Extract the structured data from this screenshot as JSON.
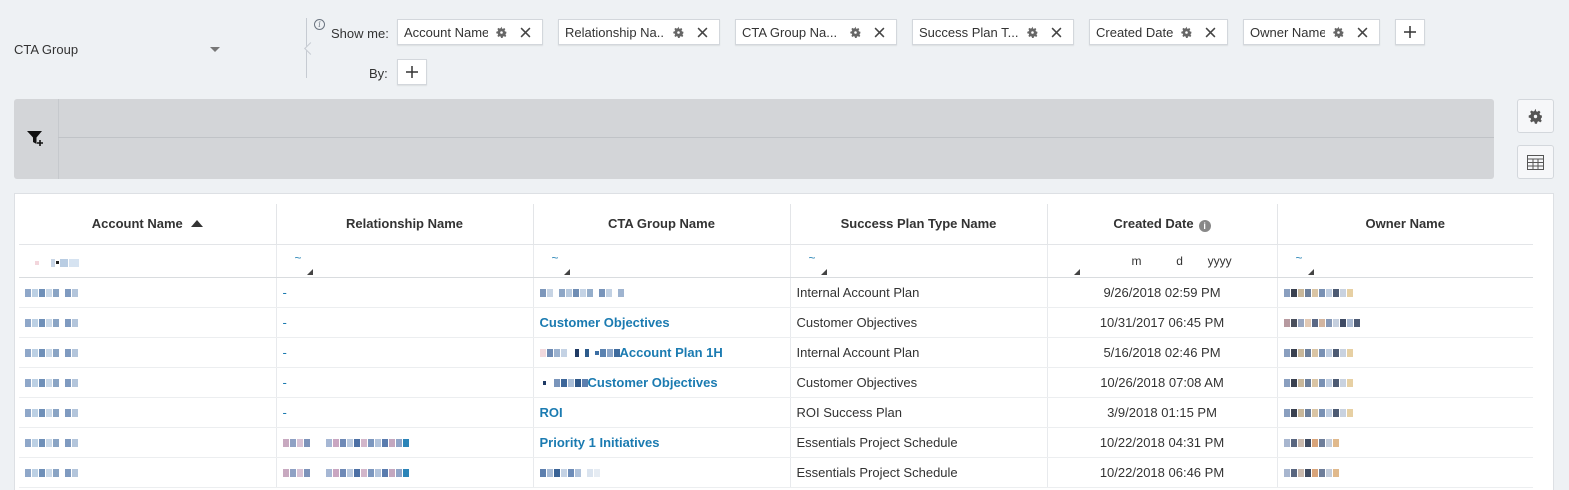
{
  "group_by": {
    "label": "CTA Group"
  },
  "show_me": {
    "label": "Show me:",
    "chips": [
      {
        "label": "Account Name"
      },
      {
        "label": "Relationship Na..."
      },
      {
        "label": "CTA Group Na..."
      },
      {
        "label": "Success Plan T..."
      },
      {
        "label": "Created Date"
      },
      {
        "label": "Owner Name"
      }
    ]
  },
  "by": {
    "label": "By:"
  },
  "table": {
    "headers": [
      "Account Name",
      "Relationship Name",
      "CTA Group Name",
      "Success Plan Type Name",
      "Created Date",
      "Owner Name"
    ],
    "date_format": {
      "m": "m",
      "d": "d",
      "y": "yyyy"
    },
    "rows": [
      {
        "relationship": "-",
        "cta_group": "",
        "plan_type": "Internal Account Plan",
        "created": "9/26/2018 02:59 PM"
      },
      {
        "relationship": "-",
        "cta_group": "Customer Objectives",
        "plan_type": "Customer Objectives",
        "created": "10/31/2017 06:45 PM"
      },
      {
        "relationship": "-",
        "cta_group": "Account Plan 1H",
        "plan_type": "Internal Account Plan",
        "created": "5/16/2018 02:46 PM"
      },
      {
        "relationship": "-",
        "cta_group": "Customer Objectives",
        "plan_type": "Customer Objectives",
        "created": "10/26/2018 07:08 AM"
      },
      {
        "relationship": "-",
        "cta_group": "ROI",
        "plan_type": "ROI Success Plan",
        "created": "3/9/2018 01:15 PM"
      },
      {
        "relationship": "",
        "cta_group": "Priority 1 Initiatives",
        "plan_type": "Essentials Project Schedule",
        "created": "10/22/2018 04:31 PM"
      },
      {
        "relationship": "",
        "cta_group": "",
        "plan_type": "Essentials Project Schedule",
        "created": "10/22/2018 06:46 PM"
      }
    ]
  },
  "colors": {
    "link": "#1b7bb1",
    "filter_band": "#d3d5d8",
    "background": "#eef1f4"
  }
}
